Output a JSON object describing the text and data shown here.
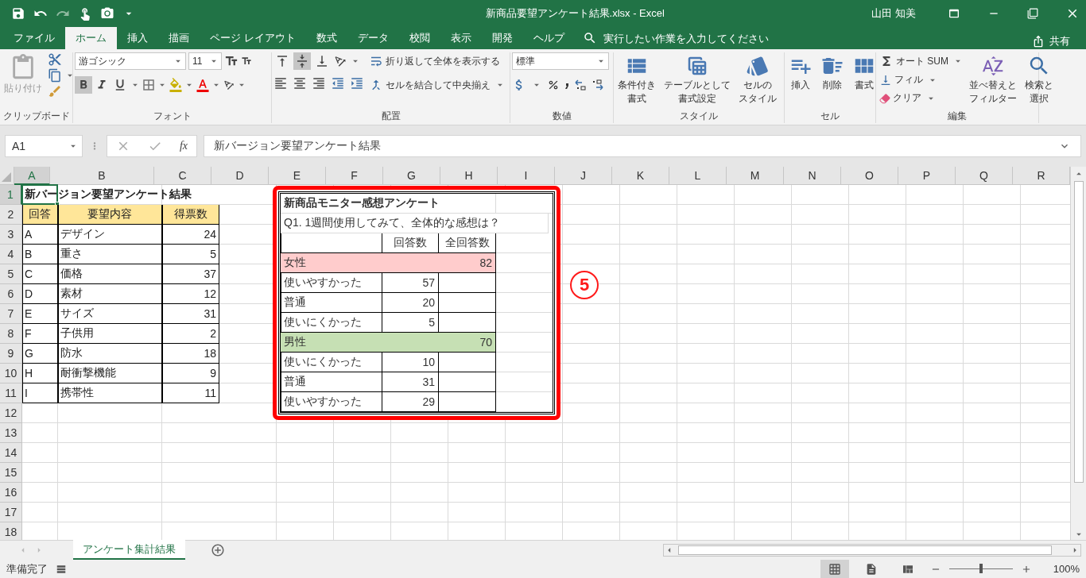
{
  "title_bar": {
    "title": "新商品要望アンケート結果.xlsx  -  Excel",
    "user": "山田 知美"
  },
  "tabs": [
    {
      "label": "ファイル",
      "selected": false
    },
    {
      "label": "ホーム",
      "selected": true
    },
    {
      "label": "挿入",
      "selected": false
    },
    {
      "label": "描画",
      "selected": false
    },
    {
      "label": "ページ レイアウト",
      "selected": false
    },
    {
      "label": "数式",
      "selected": false
    },
    {
      "label": "データ",
      "selected": false
    },
    {
      "label": "校閲",
      "selected": false
    },
    {
      "label": "表示",
      "selected": false
    },
    {
      "label": "開発",
      "selected": false
    },
    {
      "label": "ヘルプ",
      "selected": false
    }
  ],
  "tell_me": {
    "placeholder": "実行したい作業を入力してください"
  },
  "share": "共有",
  "ribbon": {
    "clipboard": {
      "label": "クリップボード",
      "paste": "貼り付け"
    },
    "font": {
      "label": "フォント",
      "name": "游ゴシック",
      "size": "11",
      "bold": true,
      "italic": false,
      "underline": false
    },
    "alignment": {
      "label": "配置",
      "vertical": [
        {
          "selected": false
        },
        {
          "selected": true
        },
        {
          "selected": false
        }
      ],
      "wrap": "折り返して全体を表示する",
      "merge": "セルを結合して中央揃え"
    },
    "number": {
      "label": "数値",
      "format": "標準"
    },
    "styles": {
      "label": "スタイル",
      "buttons": [
        {
          "lines": [
            "条件付き",
            "書式"
          ]
        },
        {
          "lines": [
            "テーブルとして",
            "書式設定"
          ]
        },
        {
          "lines": [
            "セルの",
            "スタイル"
          ]
        }
      ]
    },
    "cells": {
      "label": "セル",
      "buttons": [
        "挿入",
        "削除",
        "書式"
      ]
    },
    "editing": {
      "label": "編集",
      "autosum": "オート SUM",
      "fill": "フィル",
      "clear": "クリア",
      "sort": [
        "並べ替えと",
        "フィルター"
      ],
      "find": [
        "検索と",
        "選択"
      ]
    }
  },
  "formula_bar": {
    "name_box": "A1",
    "function_label": "fx",
    "content": "新バージョン要望アンケート結果"
  },
  "sheet": {
    "columns": [
      {
        "label": "A",
        "selected": true
      },
      {
        "label": "B",
        "selected": false
      },
      {
        "label": "C",
        "selected": false
      },
      {
        "label": "D",
        "selected": false
      },
      {
        "label": "E",
        "selected": false
      },
      {
        "label": "F",
        "selected": false
      },
      {
        "label": "G",
        "selected": false
      },
      {
        "label": "H",
        "selected": false
      },
      {
        "label": "I",
        "selected": false
      },
      {
        "label": "J",
        "selected": false
      },
      {
        "label": "K",
        "selected": false
      },
      {
        "label": "L",
        "selected": false
      },
      {
        "label": "M",
        "selected": false
      },
      {
        "label": "N",
        "selected": false
      },
      {
        "label": "O",
        "selected": false
      },
      {
        "label": "P",
        "selected": false
      },
      {
        "label": "Q",
        "selected": false
      },
      {
        "label": "R",
        "selected": false
      }
    ],
    "rows": [
      {
        "label": "1",
        "selected": true,
        "cells": [
          {
            "text": "新バージョン要望アンケート結果",
            "kind": "title"
          }
        ]
      },
      {
        "label": "2",
        "selected": false,
        "cells": [
          {
            "text": "回答",
            "kind": "header"
          },
          {
            "text": "要望内容",
            "kind": "header"
          },
          {
            "text": "得票数",
            "kind": "header"
          }
        ]
      },
      {
        "label": "3",
        "selected": false,
        "cells": [
          {
            "text": "A",
            "kind": "text"
          },
          {
            "text": "デザイン",
            "kind": "text"
          },
          {
            "text": "24",
            "kind": "number"
          }
        ]
      },
      {
        "label": "4",
        "selected": false,
        "cells": [
          {
            "text": "B",
            "kind": "text"
          },
          {
            "text": "重さ",
            "kind": "text"
          },
          {
            "text": "5",
            "kind": "number"
          }
        ]
      },
      {
        "label": "5",
        "selected": false,
        "cells": [
          {
            "text": "C",
            "kind": "text"
          },
          {
            "text": "価格",
            "kind": "text"
          },
          {
            "text": "37",
            "kind": "number"
          }
        ]
      },
      {
        "label": "6",
        "selected": false,
        "cells": [
          {
            "text": "D",
            "kind": "text"
          },
          {
            "text": "素材",
            "kind": "text"
          },
          {
            "text": "12",
            "kind": "number"
          }
        ]
      },
      {
        "label": "7",
        "selected": false,
        "cells": [
          {
            "text": "E",
            "kind": "text"
          },
          {
            "text": "サイズ",
            "kind": "text"
          },
          {
            "text": "31",
            "kind": "number"
          }
        ]
      },
      {
        "label": "8",
        "selected": false,
        "cells": [
          {
            "text": "F",
            "kind": "text"
          },
          {
            "text": "子供用",
            "kind": "text"
          },
          {
            "text": "2",
            "kind": "number"
          }
        ]
      },
      {
        "label": "9",
        "selected": false,
        "cells": [
          {
            "text": "G",
            "kind": "text"
          },
          {
            "text": "防水",
            "kind": "text"
          },
          {
            "text": "18",
            "kind": "number"
          }
        ]
      },
      {
        "label": "10",
        "selected": false,
        "cells": [
          {
            "text": "H",
            "kind": "text"
          },
          {
            "text": "耐衝撃機能",
            "kind": "text"
          },
          {
            "text": "9",
            "kind": "number"
          }
        ]
      },
      {
        "label": "11",
        "selected": false,
        "cells": [
          {
            "text": "I",
            "kind": "text"
          },
          {
            "text": "携帯性",
            "kind": "text"
          },
          {
            "text": "11",
            "kind": "number"
          }
        ]
      },
      {
        "label": "12",
        "selected": false,
        "cells": []
      },
      {
        "label": "13",
        "selected": false,
        "cells": []
      },
      {
        "label": "14",
        "selected": false,
        "cells": []
      },
      {
        "label": "15",
        "selected": false,
        "cells": []
      },
      {
        "label": "16",
        "selected": false,
        "cells": []
      },
      {
        "label": "17",
        "selected": false,
        "cells": []
      },
      {
        "label": "18",
        "selected": false,
        "cells": []
      }
    ]
  },
  "picture": {
    "title": "新商品モニター感想アンケート",
    "question": "Q1. 1週間使用してみて、全体的な感想は？",
    "headers": [
      "回答数",
      "全回答数"
    ],
    "groups": [
      {
        "label": "女性",
        "total": "82",
        "color": "#ffcccc",
        "rows": [
          {
            "label": "使いやすかった",
            "count": "57"
          },
          {
            "label": "普通",
            "count": "20"
          },
          {
            "label": "使いにくかった",
            "count": "5"
          }
        ]
      },
      {
        "label": "男性",
        "total": "70",
        "color": "#c6e0b4",
        "rows": [
          {
            "label": "使いにくかった",
            "count": "10"
          },
          {
            "label": "普通",
            "count": "31"
          },
          {
            "label": "使いやすかった",
            "count": "29"
          }
        ]
      }
    ]
  },
  "callout": "5",
  "sheet_tabs": [
    {
      "label": "アンケート集計結果",
      "selected": true
    }
  ],
  "status_bar": {
    "text": "準備完了",
    "views": [
      {
        "selected": true
      },
      {
        "selected": false
      },
      {
        "selected": false
      }
    ],
    "zoom": {
      "level": 0.5,
      "reading": "100%"
    }
  }
}
